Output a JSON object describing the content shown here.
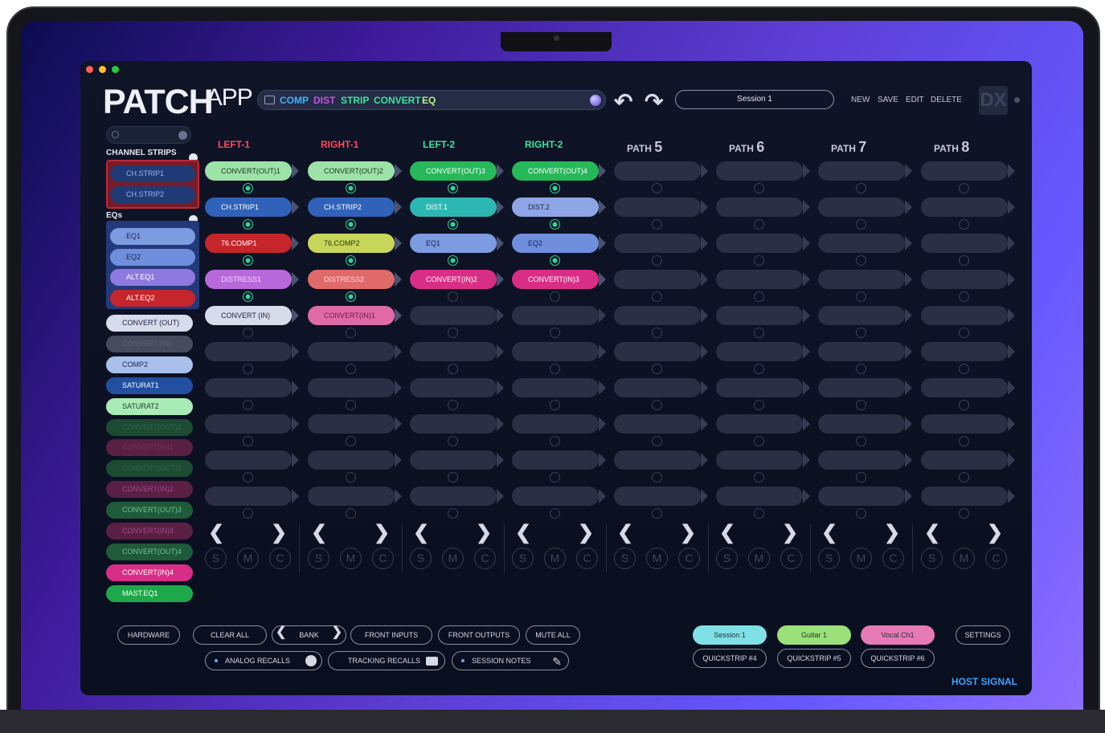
{
  "app": {
    "logo_main": "PATCH",
    "logo_small": "APP"
  },
  "chain_bar": {
    "items": [
      {
        "label": "COMP",
        "color": "#3fb3ff"
      },
      {
        "label": "DIST",
        "color": "#c552e8"
      },
      {
        "label": "STRIP",
        "color": "#3fe39a"
      },
      {
        "label": "CONVERT",
        "color": "#3fe39a"
      },
      {
        "label": "EQ",
        "color": "#b6f08a"
      }
    ]
  },
  "session": {
    "name": "Session 1"
  },
  "header_buttons": [
    "NEW",
    "SAVE",
    "EDIT",
    "DELETE"
  ],
  "brand": {
    "label": "DX"
  },
  "sidebar": {
    "channel_strips_title": "CHANNEL STRIPS",
    "channel_strips": [
      {
        "label": "CH.STRIP1",
        "bg": "#1f3a74",
        "fg": "#9ab7ee"
      },
      {
        "label": "CH.STRIP2",
        "bg": "#1f3a74",
        "fg": "#9ab7ee"
      }
    ],
    "eqs_title": "EQs",
    "eqs": [
      {
        "label": "EQ1",
        "bg": "#7d9be0",
        "fg": "#1a2550"
      },
      {
        "label": "EQ2",
        "bg": "#6f8fdc",
        "fg": "#1a2550"
      },
      {
        "label": "ALT.EQ1",
        "bg": "#8e79e0",
        "fg": "#ffffff"
      },
      {
        "label": "ALT.EQ2",
        "bg": "#c5252b",
        "fg": "#ffffff"
      }
    ],
    "modules": [
      {
        "label": "CONVERT (OUT)",
        "bg": "#d8dcea",
        "fg": "#1a2040"
      },
      {
        "label": "CONVERT (IN)",
        "bg": "#474c5c",
        "fg": "#5d6276"
      },
      {
        "label": "COMP2",
        "bg": "#a9c0ec",
        "fg": "#1a2550"
      },
      {
        "label": "SATURAT1",
        "bg": "#224fa0",
        "fg": "#ffffff"
      },
      {
        "label": "SATURAT2",
        "bg": "#a8ebb6",
        "fg": "#1a3a22"
      },
      {
        "label": "CONVERT(OUT)1",
        "bg": "#1d4a33",
        "fg": "#2c6a48"
      },
      {
        "label": "CONVERT(IN)1",
        "bg": "#5a2044",
        "fg": "#7a2e5c"
      },
      {
        "label": "CONVERT(OUT)2",
        "bg": "#1d4a33",
        "fg": "#2c6a48"
      },
      {
        "label": "CONVERT(IN)2",
        "bg": "#5a2044",
        "fg": "#a14a84"
      },
      {
        "label": "CONVERT(OUT)3",
        "bg": "#1f5a3a",
        "fg": "#6ec495"
      },
      {
        "label": "CONVERT(IN)3",
        "bg": "#5a2044",
        "fg": "#a14a84"
      },
      {
        "label": "CONVERT(OUT)4",
        "bg": "#1f5a3a",
        "fg": "#6ec495"
      },
      {
        "label": "CONVERT(IN)4",
        "bg": "#d92e86",
        "fg": "#ffffff"
      },
      {
        "label": "MAST.EQ1",
        "bg": "#1fa84a",
        "fg": "#ffffff"
      }
    ]
  },
  "paths": [
    {
      "prefix": "LEFT-1",
      "num": "",
      "color": "#ff4a5a",
      "slots": [
        {
          "label": "CONVERT(OUT)1",
          "bg": "#9de3a7",
          "fg": "#17341f"
        },
        {
          "label": "CH.STRIP1",
          "bg": "#2f62b8",
          "fg": "#ffffff"
        },
        {
          "label": "76.COMP1",
          "bg": "#c5252b",
          "fg": "#ffffff"
        },
        {
          "label": "DISTRESS1",
          "bg": "#b769da",
          "fg": "#f4d8ff"
        },
        {
          "label": "CONVERT (IN)",
          "bg": "#d8dcea",
          "fg": "#1a2040"
        }
      ],
      "nodes": [
        1,
        1,
        1,
        1,
        0,
        0,
        0,
        0,
        0,
        0
      ]
    },
    {
      "prefix": "RIGHT-1",
      "num": "",
      "color": "#ff4a5a",
      "slots": [
        {
          "label": "CONVERT(OUT)2",
          "bg": "#9de3a7",
          "fg": "#17341f"
        },
        {
          "label": "CH.STRIP2",
          "bg": "#2f62b8",
          "fg": "#ffffff"
        },
        {
          "label": "76.COMP2",
          "bg": "#c7d65a",
          "fg": "#2c3410"
        },
        {
          "label": "DISTRESS2",
          "bg": "#e06a6a",
          "fg": "#ffd7d7"
        },
        {
          "label": "CONVERT(IN)1",
          "bg": "#e06aa6",
          "fg": "#6a1d44"
        }
      ],
      "nodes": [
        1,
        1,
        1,
        1,
        0,
        0,
        0,
        0,
        0,
        0
      ]
    },
    {
      "prefix": "LEFT-2",
      "num": "",
      "color": "#3fe39a",
      "slots": [
        {
          "label": "CONVERT(OUT)3",
          "bg": "#27b85a",
          "fg": "#ffffff"
        },
        {
          "label": "DIST.1",
          "bg": "#2db7b2",
          "fg": "#ffffff"
        },
        {
          "label": "EQ1",
          "bg": "#7d9be0",
          "fg": "#1a2550"
        },
        {
          "label": "CONVERT(IN)2",
          "bg": "#d92e86",
          "fg": "#ffffff"
        },
        {
          "label": "",
          "bg": "",
          "fg": ""
        }
      ],
      "nodes": [
        1,
        1,
        1,
        0,
        0,
        0,
        0,
        0,
        0,
        0
      ]
    },
    {
      "prefix": "RIGHT-2",
      "num": "",
      "color": "#3fe39a",
      "slots": [
        {
          "label": "CONVERT(OUT)4",
          "bg": "#27b85a",
          "fg": "#ffffff"
        },
        {
          "label": "DIST.2",
          "bg": "#8ea6e6",
          "fg": "#1a2550"
        },
        {
          "label": "EQ2",
          "bg": "#6f8fdc",
          "fg": "#1a2550"
        },
        {
          "label": "CONVERT(IN)3",
          "bg": "#d92e86",
          "fg": "#ffffff"
        },
        {
          "label": "",
          "bg": "",
          "fg": ""
        }
      ],
      "nodes": [
        1,
        1,
        1,
        0,
        0,
        0,
        0,
        0,
        0,
        0
      ]
    },
    {
      "prefix": "PATH",
      "num": "5",
      "color": "#c6cad8",
      "slots": [],
      "nodes": [
        0,
        0,
        0,
        0,
        0,
        0,
        0,
        0,
        0,
        0
      ]
    },
    {
      "prefix": "PATH",
      "num": "6",
      "color": "#c6cad8",
      "slots": [],
      "nodes": [
        0,
        0,
        0,
        0,
        0,
        0,
        0,
        0,
        0,
        0
      ]
    },
    {
      "prefix": "PATH",
      "num": "7",
      "color": "#c6cad8",
      "slots": [],
      "nodes": [
        0,
        0,
        0,
        0,
        0,
        0,
        0,
        0,
        0,
        0
      ]
    },
    {
      "prefix": "PATH",
      "num": "8",
      "color": "#c6cad8",
      "slots": [],
      "nodes": [
        0,
        0,
        0,
        0,
        0,
        0,
        0,
        0,
        0,
        0
      ]
    }
  ],
  "channel_controls": {
    "prev": "❮",
    "next": "❯",
    "solo": "S",
    "mute": "M",
    "clear": "C"
  },
  "footer": {
    "hardware": "HARDWARE",
    "clear_all": "CLEAR ALL",
    "bank": "BANK",
    "front_inputs": "FRONT INPUTS",
    "front_outputs": "FRONT OUTPUTS",
    "mute_all": "MUTE ALL",
    "analog_recalls": "ANALOG RECALLS",
    "tracking_recalls": "TRACKING RECALLS",
    "session_notes": "SESSION NOTES",
    "sessions": [
      {
        "label": "Session 1",
        "bg": "#7fe0e6"
      },
      {
        "label": "Guitar 1",
        "bg": "#9ce07a"
      },
      {
        "label": "Vocal Ch1",
        "bg": "#e67ab6"
      }
    ],
    "quickstrips": [
      "QUICKSTRIP #4",
      "QUICKSTRIP #5",
      "QUICKSTRIP #6"
    ],
    "settings": "SETTINGS",
    "host_signal": "HOST SIGNAL"
  }
}
